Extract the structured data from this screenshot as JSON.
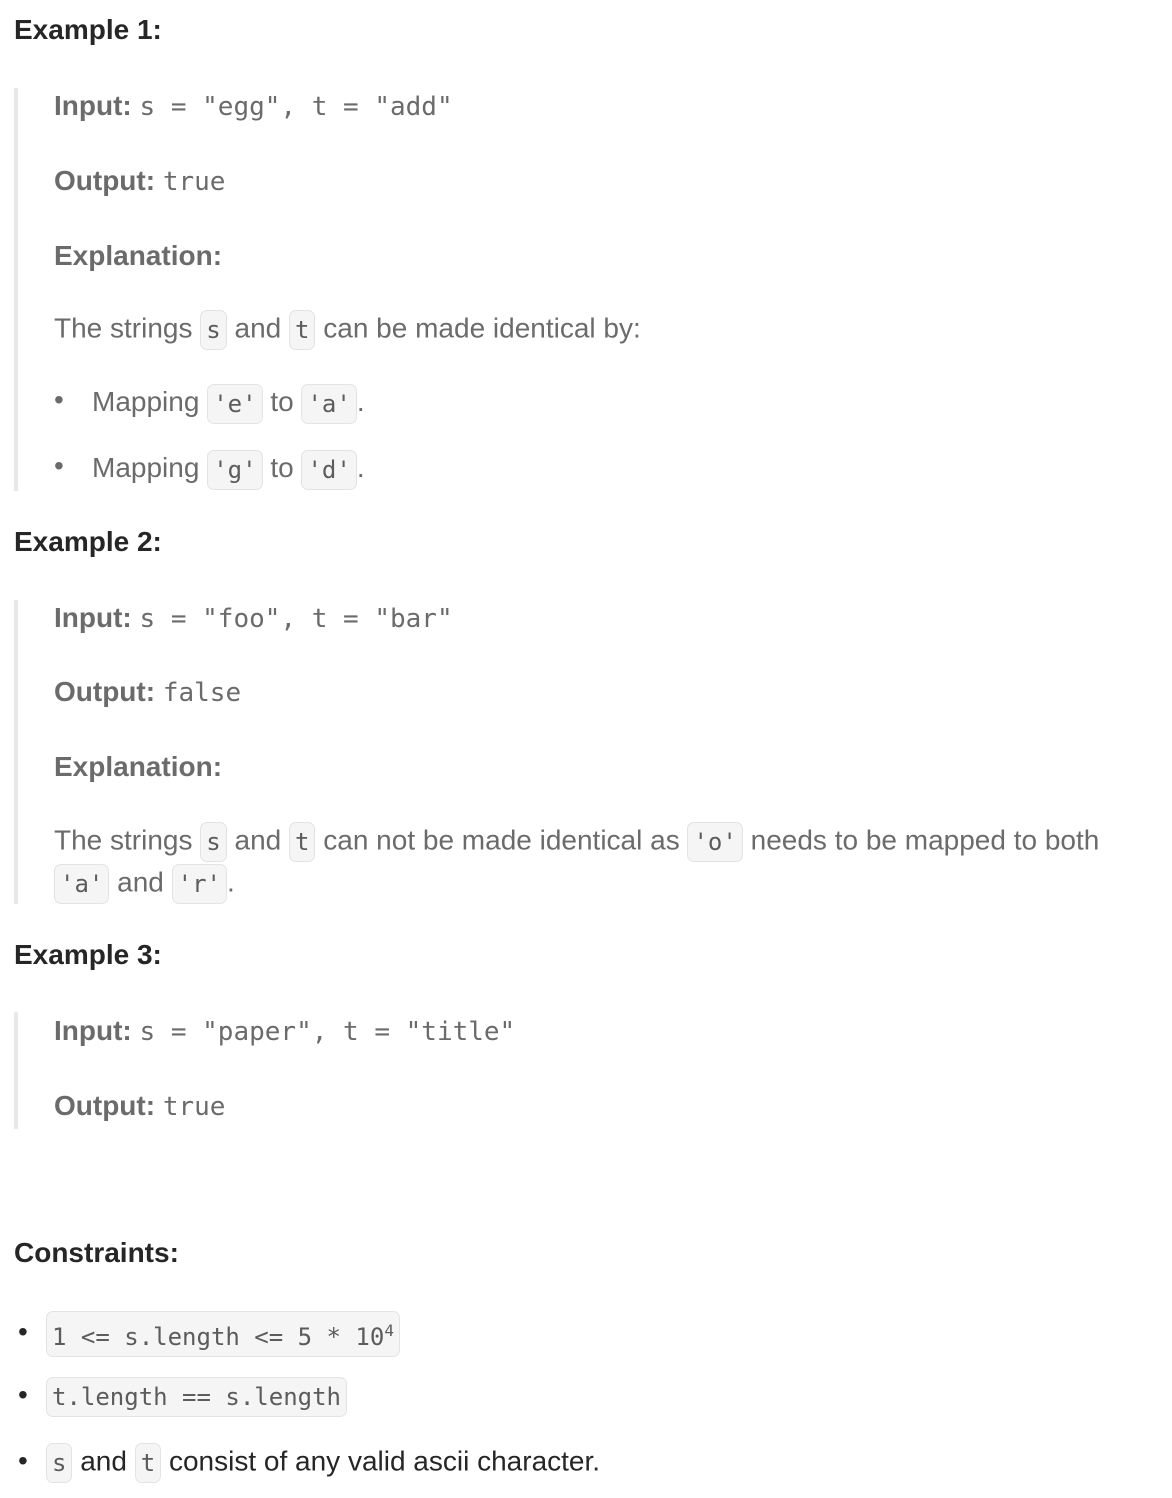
{
  "examples": [
    {
      "heading": "Example 1:",
      "input_label": "Input:",
      "input_value": "s = \"egg\", t = \"add\"",
      "output_label": "Output:",
      "output_value": "true",
      "explanation_label": "Explanation:",
      "explanation": {
        "pre": "The strings ",
        "code1": "s",
        "mid1": " and ",
        "code2": "t",
        "post": " can be made identical by:"
      },
      "bullets": [
        {
          "pre": "Mapping ",
          "from": "'e'",
          "mid": " to ",
          "to": "'a'",
          "post": "."
        },
        {
          "pre": "Mapping ",
          "from": "'g'",
          "mid": " to ",
          "to": "'d'",
          "post": "."
        }
      ]
    },
    {
      "heading": "Example 2:",
      "input_label": "Input:",
      "input_value": "s = \"foo\", t = \"bar\"",
      "output_label": "Output:",
      "output_value": "false",
      "explanation_label": "Explanation:",
      "explanation": {
        "pre": "The strings ",
        "code1": "s",
        "mid1": " and ",
        "code2": "t",
        "mid2": " can not be made identical as ",
        "code3": "'o'",
        "mid3": " needs to be mapped to both",
        "code4": "'a'",
        "mid4": " and ",
        "code5": "'r'",
        "post": "."
      }
    },
    {
      "heading": "Example 3:",
      "input_label": "Input:",
      "input_value": "s = \"paper\", t = \"title\"",
      "output_label": "Output:",
      "output_value": "true"
    }
  ],
  "constraints": {
    "heading": "Constraints:",
    "items": [
      {
        "code": "1 <= s.length <= 5 * 10",
        "sup": "4"
      },
      {
        "code": "t.length == s.length"
      },
      {
        "code1": "s",
        "mid": " and ",
        "code2": "t",
        "post": " consist of any valid ascii character."
      }
    ]
  }
}
